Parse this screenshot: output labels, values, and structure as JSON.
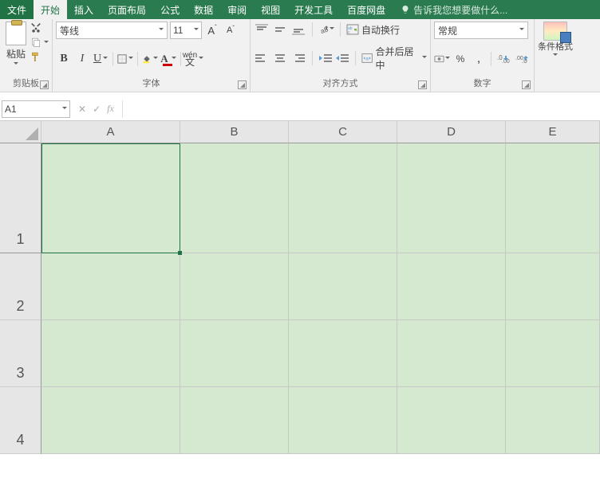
{
  "menu": {
    "file": "文件",
    "items": [
      "开始",
      "插入",
      "页面布局",
      "公式",
      "数据",
      "审阅",
      "视图",
      "开发工具",
      "百度网盘"
    ],
    "tellme": "告诉我您想要做什么..."
  },
  "ribbon": {
    "clipboard": {
      "paste": "粘贴",
      "label": "剪贴板"
    },
    "font": {
      "name": "等线",
      "size": "11",
      "label": "字体"
    },
    "align": {
      "wrap": "自动换行",
      "merge": "合并后居中",
      "label": "对齐方式"
    },
    "number": {
      "format": "常规",
      "label": "数字"
    },
    "cond": {
      "label": "条件格式"
    }
  },
  "cellref": "A1",
  "cols": [
    {
      "l": "A",
      "w": 174
    },
    {
      "l": "B",
      "w": 136
    },
    {
      "l": "C",
      "w": 136
    },
    {
      "l": "D",
      "w": 136
    },
    {
      "l": "E",
      "w": 118
    }
  ],
  "rows": [
    {
      "l": "1",
      "h": 138
    },
    {
      "l": "2",
      "h": 84
    },
    {
      "l": "3",
      "h": 84
    },
    {
      "l": "4",
      "h": 84
    }
  ]
}
